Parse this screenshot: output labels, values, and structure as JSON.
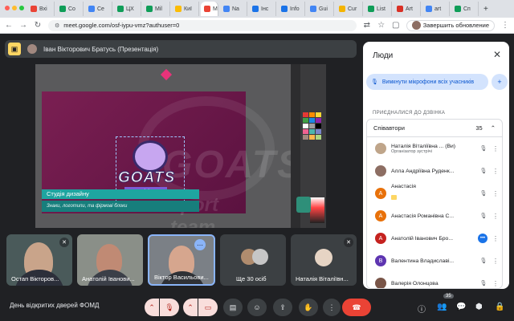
{
  "browser": {
    "tabs": [
      {
        "label": "Вхі",
        "color": "#ea4335"
      },
      {
        "label": "Co",
        "color": "#0f9d58"
      },
      {
        "label": "Се",
        "color": "#4285f4"
      },
      {
        "label": "ЦХ",
        "color": "#0f9d58"
      },
      {
        "label": "Mil",
        "color": "#0f9d58"
      },
      {
        "label": "Киї",
        "color": "#fbbc04"
      },
      {
        "label": "M",
        "color": "#ea4335"
      },
      {
        "label": "Na",
        "color": "#4285f4"
      },
      {
        "label": "Інс",
        "color": "#1a73e8"
      },
      {
        "label": "Info",
        "color": "#1a73e8"
      },
      {
        "label": "Gui",
        "color": "#4285f4"
      },
      {
        "label": "Cur",
        "color": "#f4b400"
      },
      {
        "label": "List",
        "color": "#0f9d58"
      },
      {
        "label": "Art",
        "color": "#d93025"
      },
      {
        "label": "art",
        "color": "#4285f4"
      },
      {
        "label": "Сп",
        "color": "#0f9d58"
      }
    ],
    "url": "meet.google.com/osf-iypu-vmz?authuser=0",
    "update_label": "Завершить обновление"
  },
  "presenter": {
    "name": "Іван Вікторович Братусь (Презентація)"
  },
  "slide": {
    "logo_text": "GOATS",
    "logo_sub": "sport team",
    "ghost_text": "GOATS",
    "ghost_sub": "sport team",
    "caption_title": "Студія дизайну",
    "caption_sub": "Знаки, логотипи, та фірмові блоки"
  },
  "tiles": [
    {
      "name": "Остап Вікторов..."
    },
    {
      "name": "Анатолій Іванови..."
    },
    {
      "name": "Віктор Васильови..."
    },
    {
      "name": "Ще 30 осіб"
    },
    {
      "name": "Наталія Віталіївн..."
    }
  ],
  "panel": {
    "title": "Люди",
    "mute_all": "Вимкнути мікрофони всіх учасників",
    "joined_label": "ПРИЄДНАЛИСЯ ДО ДЗВІНКА",
    "group_name": "Співавтори",
    "group_count": "35",
    "participants": [
      {
        "name": "Наталія Віталіївна ... (Ви)",
        "role": "Організатор зустрічі",
        "avatar": "",
        "color": "#bfa58a",
        "hand": false
      },
      {
        "name": "Алла Андріївна Руденк...",
        "role": "",
        "avatar": "",
        "color": "#8d6e63",
        "hand": false
      },
      {
        "name": "Анастасія",
        "role": "",
        "avatar": "А",
        "color": "#e8710a",
        "hand": true
      },
      {
        "name": "Анастасія Романівна С...",
        "role": "",
        "avatar": "А",
        "color": "#e8710a",
        "hand": false
      },
      {
        "name": "Анатолій Іванович Бро...",
        "role": "",
        "avatar": "А",
        "color": "#c5221f",
        "hand": false
      },
      {
        "name": "Валентина Владиславі...",
        "role": "",
        "avatar": "В",
        "color": "#5e35b1",
        "hand": false
      },
      {
        "name": "Валерія Олонцова",
        "role": "",
        "avatar": "",
        "color": "#795548",
        "hand": false
      }
    ]
  },
  "bottom": {
    "meeting_name": "День відкритих дверей ФОМД",
    "people_count": "35"
  },
  "colors": {
    "accent": "#1a73e8",
    "hangup": "#ea4335"
  }
}
